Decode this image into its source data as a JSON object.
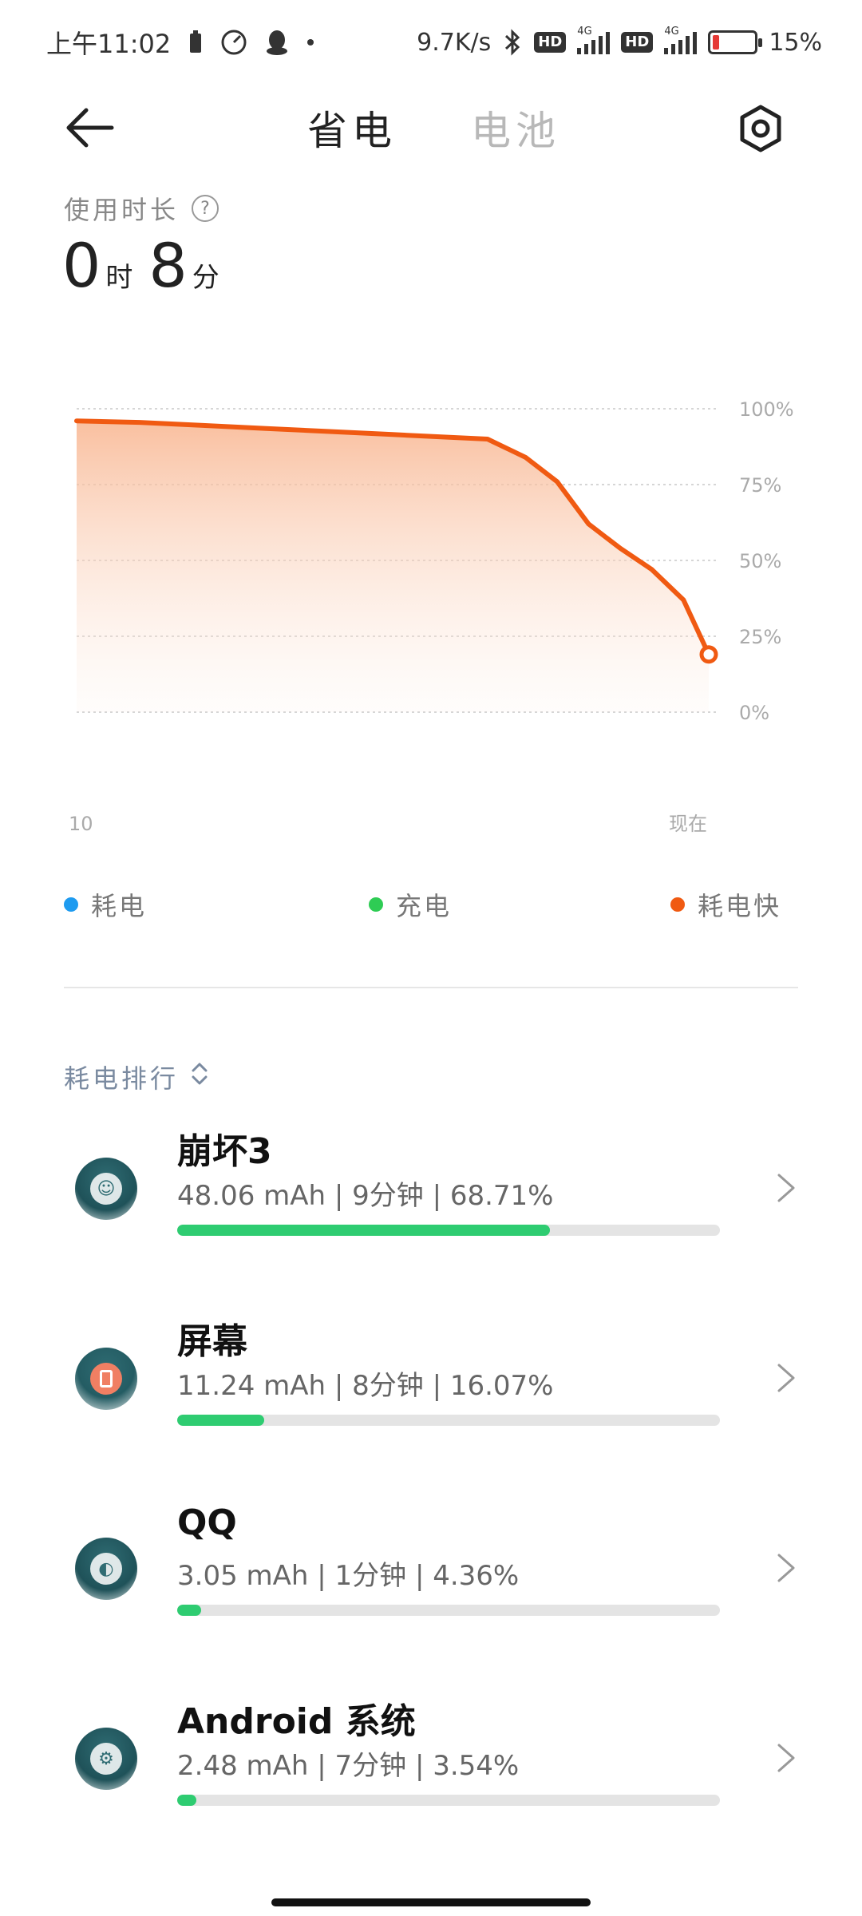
{
  "status_bar": {
    "time": "上午11:02",
    "net_speed": "9.7K/s",
    "hd1": "HD",
    "hd2": "HD",
    "net1": "4G",
    "net2": "4G",
    "battery_percent_text": "15%",
    "battery_level": 0.15,
    "battery_color": "#e53935"
  },
  "header": {
    "tab_save": "省电",
    "tab_battery": "电池"
  },
  "usage": {
    "label": "使用时长",
    "help": "?",
    "hours": "0",
    "hours_unit": "时",
    "minutes": "8",
    "minutes_unit": "分"
  },
  "chart_data": {
    "type": "area",
    "yticks": [
      "100%",
      "75%",
      "50%",
      "25%",
      "0%"
    ],
    "ylim": [
      0,
      100
    ],
    "x_labels": [
      "10",
      "现在"
    ],
    "series": [
      {
        "name": "耗电快",
        "color": "#f05a12",
        "x": [
          0,
          0.1,
          0.2,
          0.3,
          0.4,
          0.5,
          0.6,
          0.65,
          0.68,
          0.71,
          0.76,
          0.81,
          0.86,
          0.91,
          0.96,
          1.0
        ],
        "values": [
          96,
          95.5,
          94.5,
          93.5,
          92.5,
          91.5,
          90.5,
          90,
          87,
          84,
          76,
          62,
          54,
          47,
          37,
          19
        ]
      }
    ]
  },
  "legend": {
    "consume": "耗电",
    "consume_color": "#1e9bf0",
    "charge": "充电",
    "charge_color": "#2ecc54",
    "fast": "耗电快",
    "fast_color": "#f05a12"
  },
  "ranking": {
    "title": "耗电排行",
    "apps": [
      {
        "name": "崩坏3",
        "stats": "48.06 mAh | 9分钟 | 68.71%",
        "fraction": 0.6871
      },
      {
        "name": "屏幕",
        "stats": "11.24 mAh | 8分钟 | 16.07%",
        "fraction": 0.1607
      },
      {
        "name": "QQ",
        "stats": "3.05 mAh | 1分钟 | 4.36%",
        "fraction": 0.0436
      },
      {
        "name": "Android 系统",
        "stats": "2.48 mAh | 7分钟 | 3.54%",
        "fraction": 0.0354
      }
    ]
  },
  "icons": {
    "back": "back-arrow-icon",
    "settings": "settings-icon",
    "chevron": "chevron-right-icon"
  }
}
